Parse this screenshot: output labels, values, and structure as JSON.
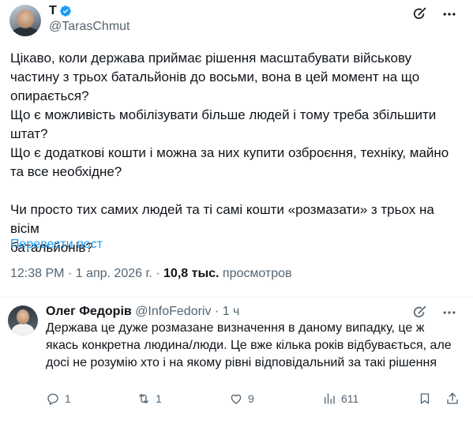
{
  "tweet": {
    "display_name": "T",
    "handle": "@TarasChmut",
    "lines": [
      "Цікаво, коли держава приймає рішення масштабувати військову",
      "частину з трьох батальйонів до восьми, вона в цей момент на що",
      "опирається?",
      "Що є можливість мобілізувати більше людей і тому треба збільшити",
      "штат?",
      "Що є додаткові кошти і можна за них купити озброєння, техніку, майно",
      "та все необхідне?",
      "Чи просто тих самих людей та ті самі кошти «розмазати» з трьох на вісім",
      "батальйонів?"
    ],
    "translate_label": "Перевести пост",
    "time": "12:38 PM",
    "date": "1 апр. 2026 г.",
    "views_count": "10,8 тыс.",
    "views_label": "просмотров",
    "sep": "·"
  },
  "reply": {
    "name": "Олег Федорів",
    "handle": "@InfoFedoriv",
    "dot": "·",
    "time": "1 ч",
    "text": "Держава це дуже розмазане визначення в даному випадку, це ж якась конкретна людина/люди. Це вже кілька років відбувається, але досі не розумію хто і на якому рівні відповідальний за такі рішення",
    "replies": "1",
    "reposts": "1",
    "likes": "9",
    "views": "611"
  },
  "icons": [
    "verified-badge-icon",
    "grok-icon",
    "more-icon",
    "reply-icon",
    "repost-icon",
    "like-icon",
    "views-icon",
    "bookmark-icon",
    "share-icon"
  ],
  "colors": {
    "accent": "#1d9bf0",
    "secondary_text": "#536471",
    "primary_text": "#0f1419"
  }
}
